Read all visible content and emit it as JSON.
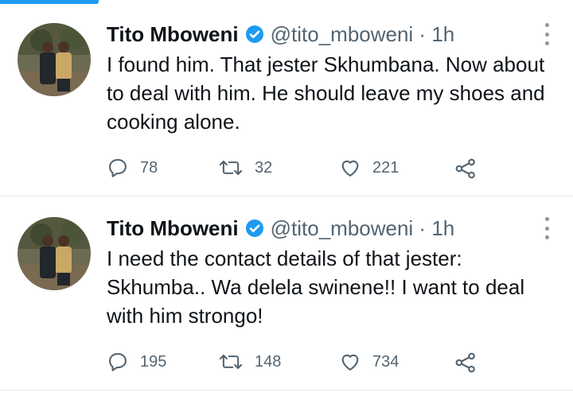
{
  "tweets": [
    {
      "name": "Tito Mboweni",
      "handle": "@tito_mboweni · 1h",
      "text": "I found him. That jester Skhumbana. Now about to deal with him. He should leave my shoes and cooking alone.",
      "replies": "78",
      "retweets": "32",
      "likes": "221"
    },
    {
      "name": "Tito Mboweni",
      "handle": "@tito_mboweni · 1h",
      "text": "I need the contact details of that jester: Skhumba.. Wa delela swinene!! I want to deal with him strongo!",
      "replies": "195",
      "retweets": "148",
      "likes": "734"
    }
  ],
  "icons": {
    "verified": "verified-badge-icon",
    "more": "more-vertical-icon",
    "reply": "reply-icon",
    "retweet": "retweet-icon",
    "like": "heart-icon",
    "share": "share-icon"
  },
  "colors": {
    "accent": "#1d9bf0",
    "text": "#0f1419",
    "secondary": "#536471",
    "divider": "#e6ecf0"
  }
}
